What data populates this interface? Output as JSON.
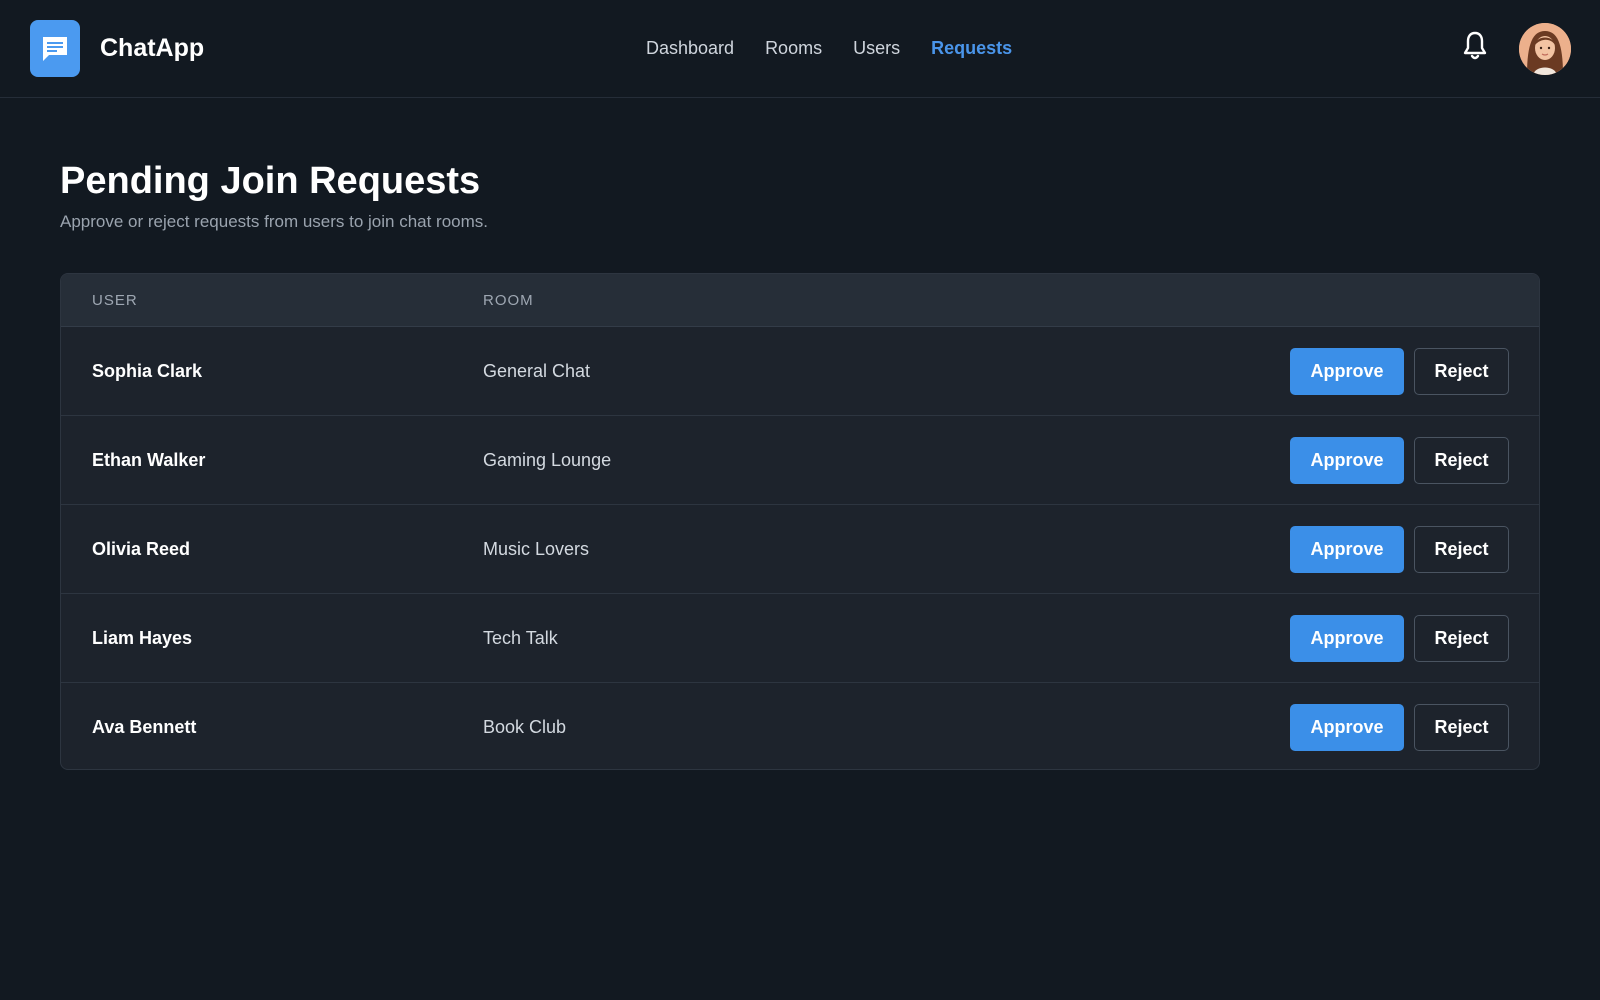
{
  "app": {
    "name": "ChatApp",
    "logo_icon": "chat-bubble-icon",
    "accent_color": "#3b8fe8"
  },
  "nav": {
    "items": [
      {
        "label": "Dashboard",
        "active": false
      },
      {
        "label": "Rooms",
        "active": false
      },
      {
        "label": "Users",
        "active": false
      },
      {
        "label": "Requests",
        "active": true
      }
    ]
  },
  "header_actions": {
    "notification_icon": "bell-icon",
    "avatar_icon": "user-avatar"
  },
  "page": {
    "title": "Pending Join Requests",
    "subtitle": "Approve or reject requests from users to join chat rooms."
  },
  "table": {
    "columns": [
      "USER",
      "ROOM"
    ],
    "rows": [
      {
        "user": "Sophia Clark",
        "room": "General Chat",
        "approve_label": "Approve",
        "reject_label": "Reject"
      },
      {
        "user": "Ethan Walker",
        "room": "Gaming Lounge",
        "approve_label": "Approve",
        "reject_label": "Reject"
      },
      {
        "user": "Olivia Reed",
        "room": "Music Lovers",
        "approve_label": "Approve",
        "reject_label": "Reject"
      },
      {
        "user": "Liam Hayes",
        "room": "Tech Talk",
        "approve_label": "Approve",
        "reject_label": "Reject"
      },
      {
        "user": "Ava Bennett",
        "room": "Book Club",
        "approve_label": "Approve",
        "reject_label": "Reject"
      }
    ]
  }
}
